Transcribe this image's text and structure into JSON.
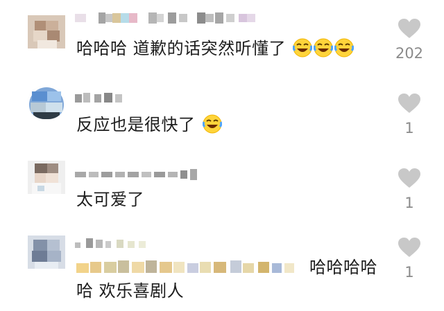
{
  "comments": [
    {
      "text": "哈哈哈 道歉的话突然听懂了",
      "emoji": [
        "laughing-emoji",
        "laughing-emoji",
        "laughing-emoji"
      ],
      "likes": "202"
    },
    {
      "text": "反应也是很快了",
      "emoji": [
        "laughing-emoji"
      ],
      "likes": "1"
    },
    {
      "text": "太可爱了",
      "emoji": [],
      "likes": "1"
    },
    {
      "text_visible_end": "哈哈哈哈",
      "text_line2": "哈 欢乐喜剧人",
      "emoji": [],
      "likes": "1"
    }
  ],
  "icons": {
    "like": "heart-icon",
    "emoji": "laughing-emoji"
  },
  "colors": {
    "heart": "#c8c8c8",
    "count": "#8a8a8a",
    "text": "#1d1d1d",
    "background": "#ffffff"
  }
}
